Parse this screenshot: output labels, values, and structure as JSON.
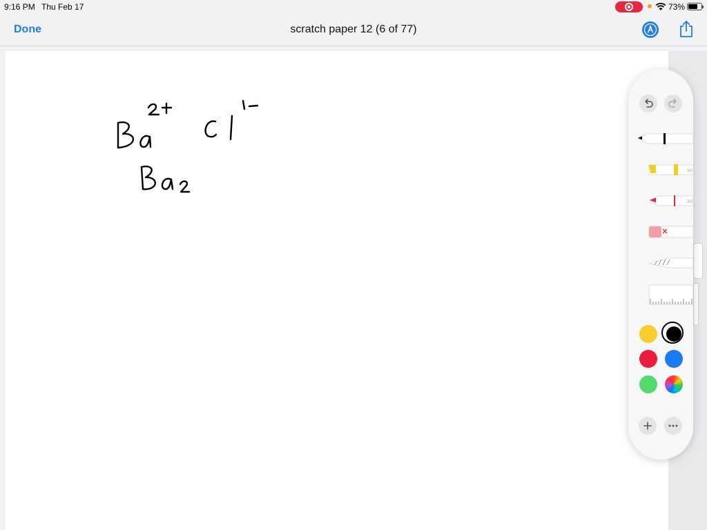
{
  "status_bar": {
    "time": "9:16 PM",
    "date": "Thu Feb 17",
    "battery_percent": "73%",
    "battery_level": 0.73,
    "recording": true
  },
  "nav": {
    "done_label": "Done",
    "title": "scratch paper 12 (6 of 77)",
    "markup_icon": "markup-pen-icon",
    "share_icon": "share-icon"
  },
  "canvas": {
    "handwriting_lines": [
      {
        "text": "Ba²⁺  Cl¹⁻"
      },
      {
        "text": "Ba₂"
      }
    ]
  },
  "palette": {
    "undo_icon": "undo-arrow-icon",
    "redo_icon": "redo-arrow-icon",
    "tools": [
      {
        "name": "pen",
        "icon": "pen-tool-icon",
        "color": "#000000",
        "selected": true
      },
      {
        "name": "highlighter",
        "icon": "highlighter-tool-icon",
        "color": "#f5cc22",
        "size_label": "50"
      },
      {
        "name": "pencil",
        "icon": "pencil-tool-icon",
        "color": "#e5283d",
        "size_label": "20"
      },
      {
        "name": "eraser",
        "icon": "eraser-tool-icon",
        "color": "#f0a0a4"
      },
      {
        "name": "lasso",
        "icon": "lasso-tool-icon"
      },
      {
        "name": "ruler",
        "icon": "ruler-tool-icon"
      }
    ],
    "colors": [
      {
        "name": "yellow",
        "hex": "#f8cd2c",
        "selected": false
      },
      {
        "name": "black",
        "hex": "#000000",
        "selected": true
      },
      {
        "name": "red",
        "hex": "#eb1c3c",
        "selected": false
      },
      {
        "name": "blue",
        "hex": "#1b7bf0",
        "selected": false
      },
      {
        "name": "green",
        "hex": "#55d86c",
        "selected": false
      },
      {
        "name": "color-picker",
        "hex": "multicolor",
        "selected": false
      }
    ],
    "add_icon": "plus-icon",
    "more_icon": "ellipsis-icon"
  }
}
